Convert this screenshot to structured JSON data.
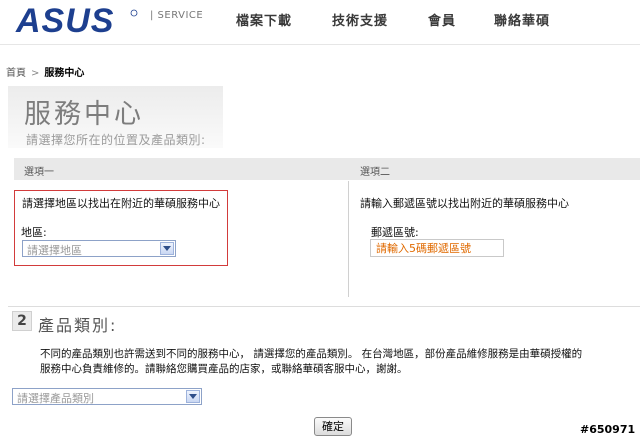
{
  "header": {
    "brand": "ASUS",
    "service_label": "| SERVICE",
    "nav": [
      {
        "label": "檔案下載"
      },
      {
        "label": "技術支援"
      },
      {
        "label": "會員"
      },
      {
        "label": "聯絡華碩"
      }
    ]
  },
  "breadcrumb": {
    "home": "首頁",
    "separator": ">",
    "current": "服務中心"
  },
  "page": {
    "title": "服務中心",
    "subtitle": "請選擇您所在的位置及產品類別:"
  },
  "options": {
    "option1": {
      "label": "選項一",
      "instruction": "請選擇地區以找出在附近的華碩服務中心",
      "region_label": "地區:",
      "region_select_value": "請選擇地區"
    },
    "option2": {
      "label": "選項二",
      "instruction": "請輸入郵遞區號以找出附近的華碩服務中心",
      "zip_label": "郵遞區號:",
      "zip_placeholder": "請輸入5碼郵遞區號"
    }
  },
  "step2": {
    "number": "2",
    "title": "產品類別:",
    "description_line1": "不同的產品類別也許需送到不同的服務中心， 請選擇您的產品類別。 在台灣地區，部份產品維修服務是由華碩授權的",
    "description_line2": "服務中心負責維修的。請聯絡您購買產品的店家，或聯絡華碩客服中心，謝謝。",
    "category_select_value": "請選擇產品類別"
  },
  "confirm_label": "確定",
  "watermark": "#650971",
  "colors": {
    "highlight_border": "#d23b3b",
    "zip_text": "#e06a00",
    "logo_blue": "#1d3f8f"
  }
}
